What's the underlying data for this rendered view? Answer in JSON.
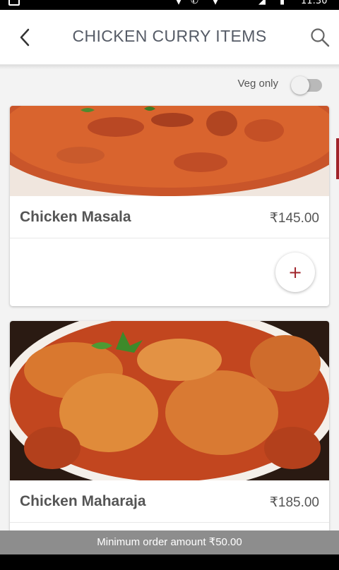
{
  "status_bar": {
    "time": "11:30"
  },
  "header": {
    "title": "CHICKEN CURRY ITEMS"
  },
  "filter": {
    "veg_only_label": "Veg only",
    "veg_only_enabled": false
  },
  "items": [
    {
      "name": "Chicken Masala",
      "price": "₹145.00",
      "add_label": "+"
    },
    {
      "name": "Chicken Maharaja",
      "price": "₹185.00"
    }
  ],
  "footer": {
    "min_order": "Minimum order amount ₹50.00"
  },
  "colors": {
    "accent": "#a0242b",
    "title_text": "#555b66",
    "footer_bg": "#8d8d8d"
  }
}
